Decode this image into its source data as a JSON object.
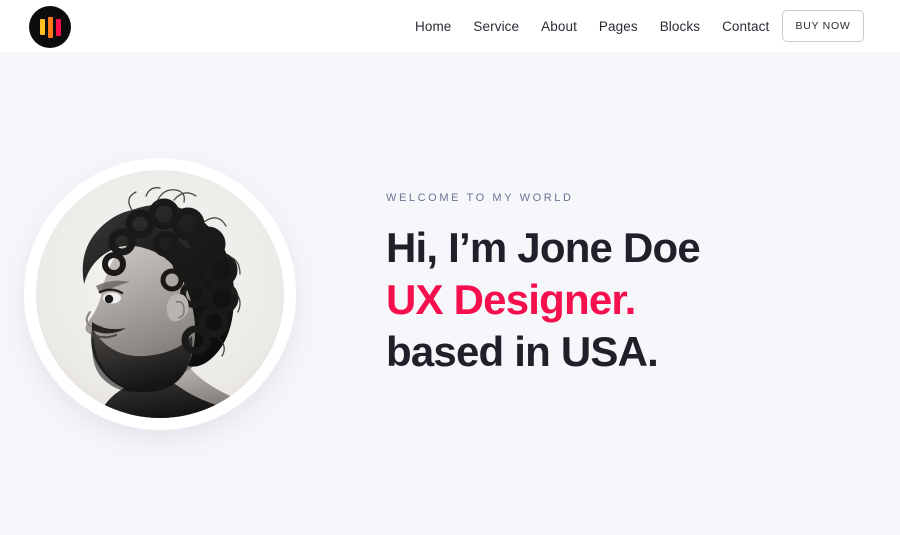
{
  "theme": {
    "page_background": "#f6f7fb",
    "header_background": "#ffffff",
    "accent_pink": "#f5104d",
    "heading_dark": "#1f2029",
    "muted_text": "#6c7293",
    "logo_background": "#0c0c0c",
    "logo_bar_colors": [
      "#ffc021",
      "#ff7a1a",
      "#f5104d"
    ]
  },
  "header": {
    "logo": {
      "icon": "equalizer-bars-logo-icon",
      "shape": "circle"
    },
    "nav_items": [
      {
        "label": "Home"
      },
      {
        "label": "Service"
      },
      {
        "label": "About"
      },
      {
        "label": "Pages"
      },
      {
        "label": "Blocks"
      },
      {
        "label": "Contact"
      }
    ],
    "cta": {
      "label": "BUY NOW"
    }
  },
  "hero": {
    "portrait": {
      "icon": "profile-portrait-photo",
      "alt": "Black and white side profile photograph of a bearded man with curly hair"
    },
    "eyebrow": "WELCOME TO MY WORLD",
    "headline": [
      {
        "text": "Hi, I’m Jone Doe",
        "style": "dark"
      },
      {
        "text": "UX Designer.",
        "style": "accent"
      },
      {
        "text": "based in USA.",
        "style": "dark"
      }
    ]
  }
}
